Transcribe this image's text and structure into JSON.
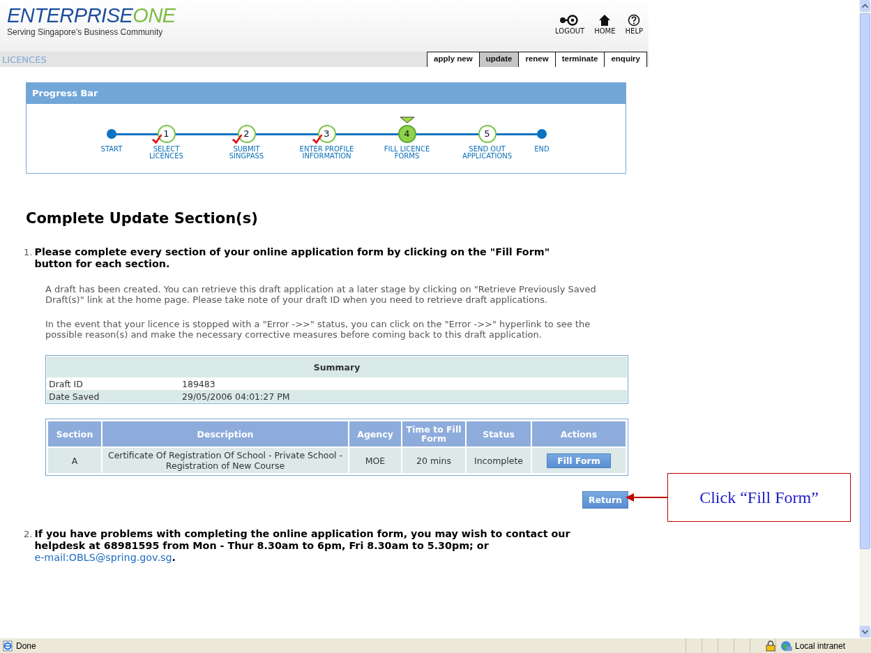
{
  "header": {
    "logo": {
      "main": "ENTERPRISE",
      "accent": "ONE"
    },
    "tagline": "Serving Singapore’s Business Community",
    "links": [
      {
        "kind": "logout",
        "label": "LOGOUT"
      },
      {
        "kind": "home",
        "label": "HOME"
      },
      {
        "kind": "help",
        "label": "HELP"
      }
    ]
  },
  "nav": {
    "section": "LICENCES",
    "tabs": [
      {
        "label": "apply new",
        "selected": false
      },
      {
        "label": "update",
        "selected": true
      },
      {
        "label": "renew",
        "selected": false
      },
      {
        "label": "terminate",
        "selected": false
      },
      {
        "label": "enquiry",
        "selected": false
      }
    ]
  },
  "progress": {
    "title": "Progress Bar",
    "steps": [
      {
        "kind": "endpoint",
        "label": "START"
      },
      {
        "kind": "done",
        "number": "1",
        "label": "SELECT\nLICENCES"
      },
      {
        "kind": "done",
        "number": "2",
        "label": "SUBMIT\nSINGPASS"
      },
      {
        "kind": "done",
        "number": "3",
        "label": "ENTER PROFILE\nINFORMATION"
      },
      {
        "kind": "current",
        "number": "4",
        "label": "FILL LICENCE\nFORMS"
      },
      {
        "kind": "pending",
        "number": "5",
        "label": "SEND OUT\nAPPLICATIONS"
      },
      {
        "kind": "endpoint",
        "label": "END"
      }
    ]
  },
  "heading": "Complete Update Section(s)",
  "item_1": {
    "number": "1.",
    "text": "Please complete every section of your online application form by clicking on the \"Fill Form\" button for each section.",
    "notes": [
      "A draft has been created. You can retrieve this draft application at a later stage by clicking on \"Retrieve Previously Saved Draft(s)\" link at the home page. Please take note of your draft ID when you need to retrieve draft applications.",
      "In the event that your licence is stopped with a \"Error ->>\" status, you can click on the \"Error ->>\" hyperlink to see the possible reason(s) and make the necessary corrective measures before coming back to this draft application."
    ]
  },
  "summary": {
    "title": "Summary",
    "rows": [
      {
        "label": "Draft ID",
        "value": "189483"
      },
      {
        "label": "Date Saved",
        "value": "29/05/2006 04:01:27 PM"
      }
    ]
  },
  "sections_table": {
    "columns": [
      "Section",
      "Description",
      "Agency",
      "Time to Fill Form",
      "Status",
      "Actions"
    ],
    "rows": [
      {
        "cells": [
          "A",
          "Certificate Of Registration Of School - Private School - Registration of New Course",
          "MOE",
          "20 mins",
          "Incomplete"
        ],
        "action": "Fill Form"
      }
    ]
  },
  "return_button": "Return",
  "item_2": {
    "number": "2.",
    "text": "If you have problems with completing the online application form, you may wish to contact our helpdesk at 68981595 from Mon - Thur 8.30am to 6pm, Fri 8.30am to 5.30pm; or ",
    "link": "e-mail:OBLS@spring.gov.sg",
    "after": "."
  },
  "callout": {
    "text": "Click “Fill Form”"
  },
  "status_bar": {
    "text": "Done",
    "zone": "Local intranet"
  }
}
